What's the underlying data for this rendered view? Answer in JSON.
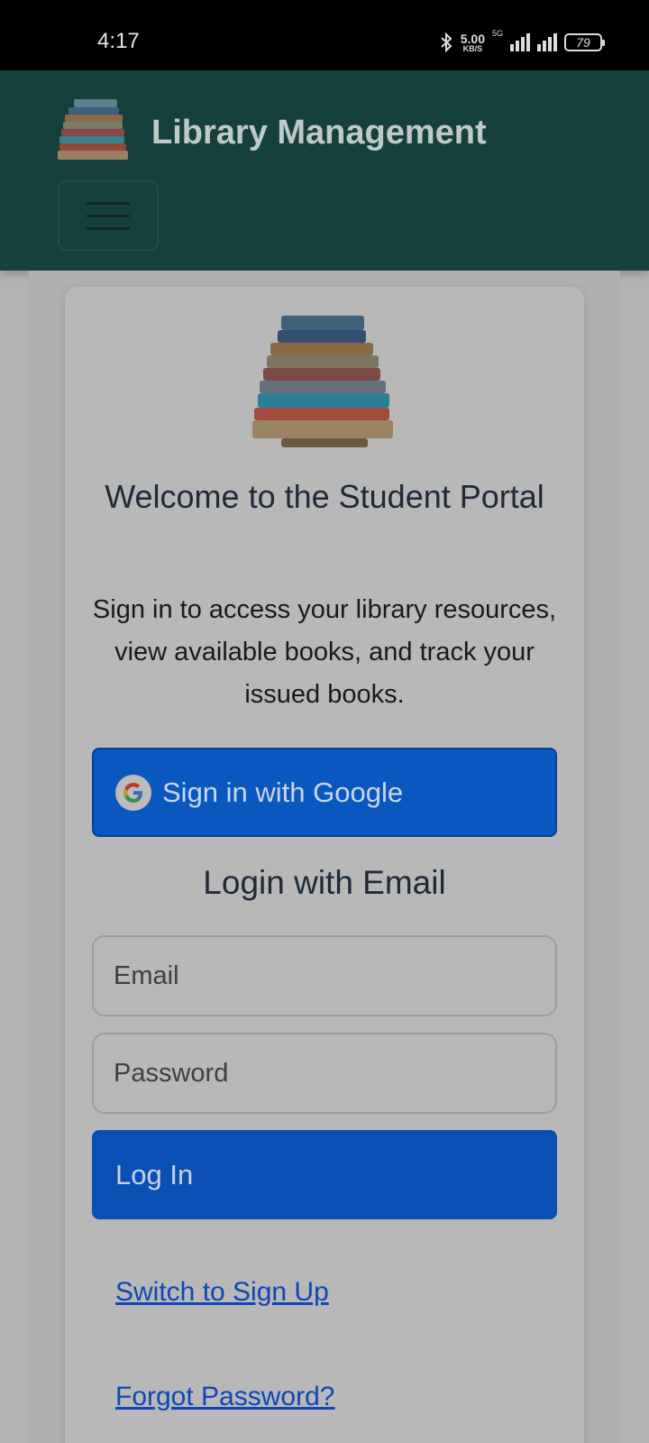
{
  "status_bar": {
    "time": "4:17",
    "speed_value": "5.00",
    "speed_unit": "KB/S",
    "network": "5G",
    "battery": "79"
  },
  "header": {
    "title": "Library Management",
    "logo_icon": "books-stack-icon",
    "menu_icon": "hamburger-menu-icon",
    "background": "#16403e"
  },
  "login_card": {
    "logo_icon": "books-stack-icon",
    "welcome_title": "Welcome to the Student Portal",
    "intro_text": "Sign in to access your library resources, view available books, and track your issued books.",
    "google_button": {
      "label": "Sign in with Google",
      "icon": "google-logo-icon",
      "color": "#0a57c0"
    },
    "email_login_heading": "Login with Email",
    "email_field": {
      "placeholder": "Email",
      "value": ""
    },
    "password_field": {
      "placeholder": "Password",
      "value": ""
    },
    "login_button": {
      "label": "Log In",
      "color": "#0a4fb3"
    },
    "switch_link": "Switch to Sign Up",
    "forgot_link": "Forgot Password?"
  }
}
